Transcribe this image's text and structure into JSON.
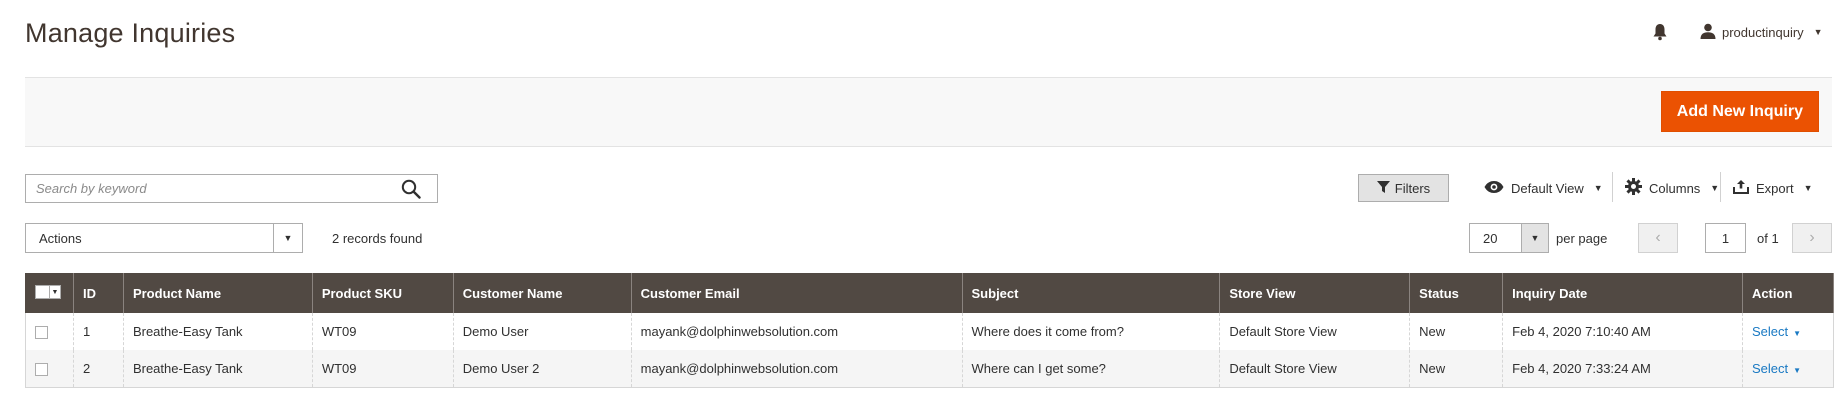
{
  "header": {
    "title": "Manage Inquiries",
    "user_name": "productinquiry",
    "icons": {
      "notification": "bell-icon",
      "user": "user-icon"
    }
  },
  "actionbar": {
    "add_button_label": "Add New Inquiry"
  },
  "toolbar": {
    "search_placeholder": "Search by keyword",
    "filters_label": "Filters",
    "view_label": "Default View",
    "columns_label": "Columns",
    "export_label": "Export",
    "actions_label": "Actions",
    "records_found": "2 records found",
    "per_page_value": "20",
    "per_page_label": "per page",
    "current_page": "1",
    "of_pages": "of 1"
  },
  "grid": {
    "columns": [
      "ID",
      "Product Name",
      "Product SKU",
      "Customer Name",
      "Customer Email",
      "Subject",
      "Store View",
      "Status",
      "Inquiry Date",
      "Action"
    ],
    "rows": [
      {
        "id": "1",
        "product_name": "Breathe-Easy Tank",
        "sku": "WT09",
        "customer_name": "Demo User",
        "email": "mayank@dolphinwebsolution.com",
        "subject": "Where does it come from?",
        "store_view": "Default Store View",
        "status": "New",
        "date": "Feb 4, 2020 7:10:40 AM",
        "action": "Select"
      },
      {
        "id": "2",
        "product_name": "Breathe-Easy Tank",
        "sku": "WT09",
        "customer_name": "Demo User 2",
        "email": "mayank@dolphinwebsolution.com",
        "subject": "Where can I get some?",
        "store_view": "Default Store View",
        "status": "New",
        "date": "Feb 4, 2020 7:33:24 AM",
        "action": "Select"
      }
    ]
  },
  "colors": {
    "accent": "#eb5202",
    "header_bg": "#514943",
    "link": "#1979c3"
  }
}
